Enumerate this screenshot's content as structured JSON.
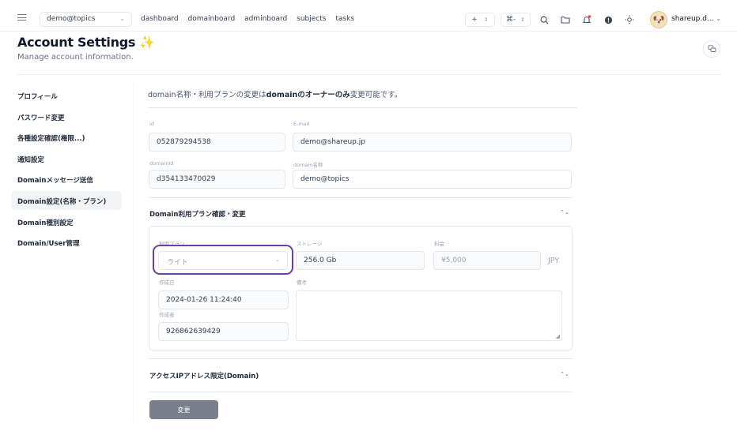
{
  "topbar": {
    "workspace": "demo@topics",
    "nav": [
      "dashboard",
      "domainboard",
      "adminboard",
      "subjects",
      "tasks"
    ],
    "add_label": "+",
    "sort_glyph": "⌘-",
    "user_name": "shareup.d...",
    "icons": [
      "menu-icon",
      "search-icon",
      "folder-icon",
      "bell-icon",
      "alert-icon",
      "sun-icon",
      "chevron-down-icon"
    ],
    "colors": {
      "notification_dot": "#ef4444"
    }
  },
  "header": {
    "title": "Account Settings",
    "subtitle": "Manage account information."
  },
  "sidebar": {
    "items": [
      "プロフィール",
      "パスワード変更",
      "各種設定確認(権限...)",
      "通知設定",
      "Domainメッセージ送信",
      "Domain設定(名称・プラン)",
      "Domain種別設定",
      "Domain/User管理"
    ],
    "active_index": 5
  },
  "notice": {
    "part1": "domain名称・利用プランの変更は",
    "bold": "domainのオーナーのみ",
    "part2": "変更可能です。"
  },
  "form": {
    "id_label": "id",
    "id_value": "052879294538",
    "email_label": "E-mail",
    "email_value": "demo@shareup.jp",
    "domainid_label": "domainId",
    "domainid_value": "d354133470029",
    "domainname_label": "domain名称",
    "domainname_value": "demo@topics"
  },
  "plan_section": {
    "title": "Domain利用プラン確認・変更",
    "plan_label": "利用プラン",
    "plan_value": "ライト",
    "storage_label": "ストレージ",
    "storage_value": "256.0 Gb",
    "price_label": "料金",
    "price_value": "¥5,000",
    "currency": "JPY",
    "created_label": "作成日",
    "created_value": "2024-01-26 11:24:40",
    "creator_label": "作成者",
    "creator_value": "926862639429",
    "note_label": "備考",
    "highlight_color": "#6b3fa8"
  },
  "ip_section": {
    "title": "アクセスIPアドレス限定(Domain)"
  },
  "submit_label": "変更"
}
